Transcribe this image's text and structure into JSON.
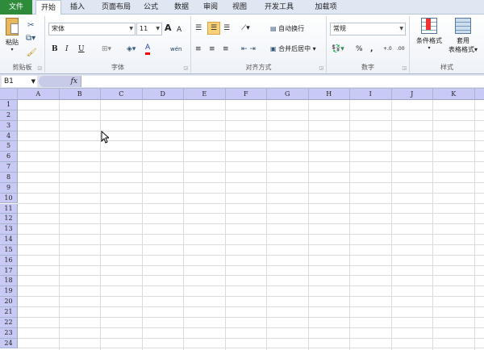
{
  "tabs": [
    "文件",
    "开始",
    "插入",
    "页面布局",
    "公式",
    "数据",
    "审阅",
    "视图",
    "开发工具",
    "加载项"
  ],
  "active_tab": "开始",
  "ribbon": {
    "clipboard": {
      "paste": "粘贴",
      "label": "剪贴板"
    },
    "font": {
      "name": "宋体",
      "size": "11",
      "bold": "B",
      "italic": "I",
      "underline": "U",
      "font_color": "A",
      "grow": "A",
      "shrink": "A",
      "phonetic": "wén",
      "label": "字体"
    },
    "alignment": {
      "wrap": "自动换行",
      "merge": "合并后居中",
      "label": "对齐方式"
    },
    "number": {
      "format": "常规",
      "percent": "%",
      "comma": ",",
      "inc_dec": "+.0",
      "dec_dec": ".00",
      "label": "数字"
    },
    "styles": {
      "conditional": "条件格式",
      "table1": "套用",
      "table2": "表格格式",
      "label": "样式"
    }
  },
  "formula_bar": {
    "name_box": "B1",
    "fx": "fx",
    "value": ""
  },
  "columns": [
    "A",
    "B",
    "C",
    "D",
    "E",
    "F",
    "G",
    "H",
    "I",
    "J",
    "K"
  ],
  "rows": [
    "1",
    "2",
    "3",
    "4",
    "5",
    "6",
    "7",
    "8",
    "9",
    "10",
    "11",
    "12",
    "13",
    "14",
    "15",
    "16",
    "17",
    "18",
    "19",
    "20",
    "21",
    "22",
    "23",
    "24"
  ],
  "colors": {
    "header": "#c9c9f5",
    "file_tab": "#2e8b3a"
  }
}
